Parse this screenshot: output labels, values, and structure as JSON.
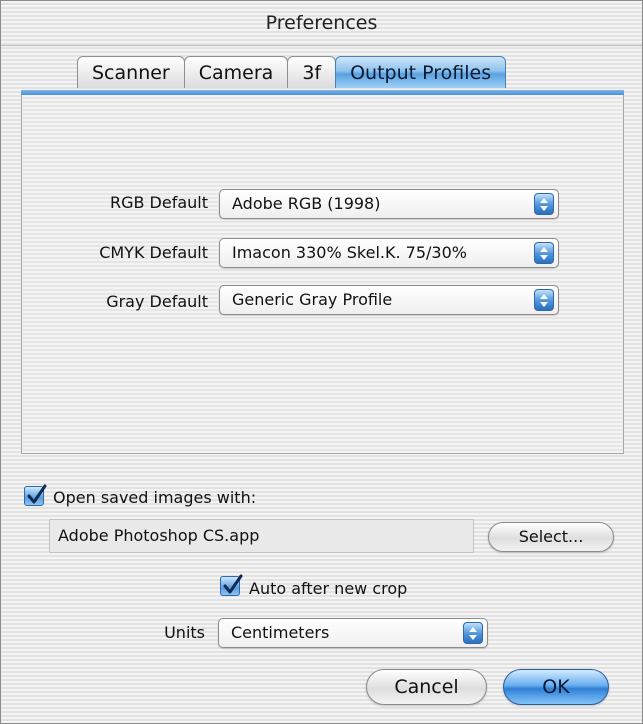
{
  "window": {
    "title": "Preferences"
  },
  "tabs": [
    {
      "label": "Scanner",
      "active": false
    },
    {
      "label": "Camera",
      "active": false
    },
    {
      "label": "3f",
      "active": false
    },
    {
      "label": "Output Profiles",
      "active": true
    }
  ],
  "output_profiles": {
    "rgb_default": {
      "label": "RGB Default",
      "value": "Adobe RGB (1998)"
    },
    "cmyk_default": {
      "label": "CMYK Default",
      "value": "Imacon 330% Skel.K.  75/30%"
    },
    "gray_default": {
      "label": "Gray Default",
      "value": "Generic Gray Profile"
    }
  },
  "open_saved": {
    "label": "Open saved images with:",
    "checked": true,
    "app_path": "Adobe Photoshop CS.app",
    "select_label": "Select..."
  },
  "auto_crop": {
    "label": "Auto after new crop",
    "checked": true
  },
  "units": {
    "label": "Units",
    "value": "Centimeters"
  },
  "buttons": {
    "cancel": "Cancel",
    "ok": "OK"
  },
  "colors": {
    "accent": "#4b8fd3",
    "default_button": "#2f7fd6"
  }
}
